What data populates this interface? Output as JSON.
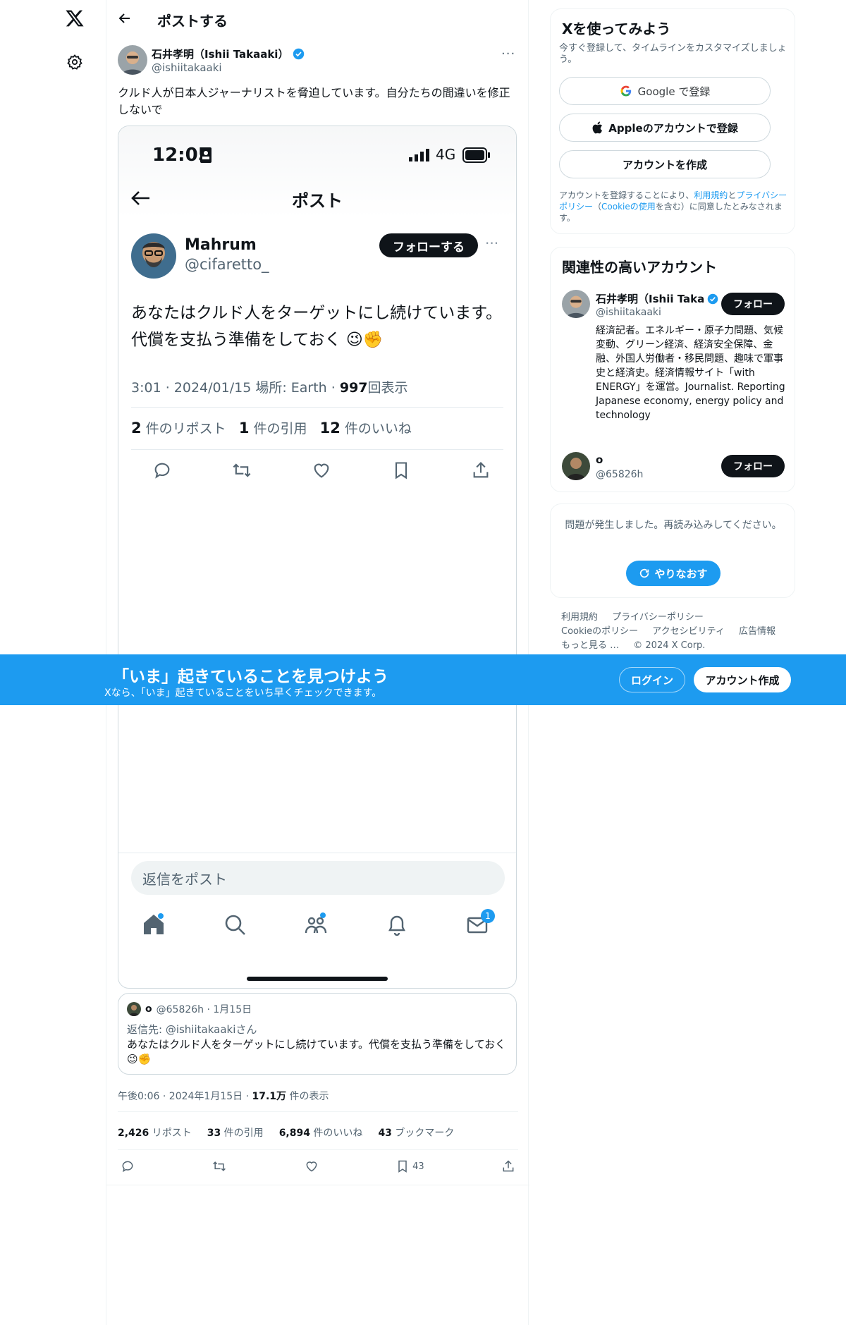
{
  "nav": {
    "logo": "x-logo-icon",
    "settings": "gear-icon"
  },
  "header": {
    "title": "ポストする"
  },
  "post": {
    "author_name": "石井孝明（Ishii Takaaki）",
    "author_handle": "@ishiitakaaki",
    "more": "···",
    "text": "クルド人が日本人ジャーナリストを脅迫しています。自分たちの間違いを修正しないで",
    "meta_time": "午後0:06 · 2024年1月15日 · ",
    "meta_views_num": "17.1万",
    "meta_views_label": " 件の表示",
    "stats": [
      {
        "num": "2,426",
        "label": " リポスト"
      },
      {
        "num": "33",
        "label": " 件の引用"
      },
      {
        "num": "6,894",
        "label": " 件のいいね"
      },
      {
        "num": "43",
        "label": " ブックマーク"
      }
    ],
    "bookmark_count": "43"
  },
  "embed": {
    "time": "12:05",
    "network": "4G",
    "title": "ポスト",
    "name": "Mahrum",
    "handle": "@cifaretto_",
    "follow": "フォローする",
    "text": "あなたはクルド人をターゲットにし続けています。代償を支払う準備をしておく 😉✊",
    "meta_time": "3:01 · 2024/01/15 場所: Earth · ",
    "meta_views": "997",
    "meta_views_label": "回表示",
    "reposts_num": "2",
    "reposts_label": "件のリポスト",
    "quotes_num": "1",
    "quotes_label": "件の引用",
    "likes_num": "12",
    "likes_label": "件のいいね",
    "reply_placeholder": "返信をポスト",
    "dm_badge": "1"
  },
  "quote": {
    "name": "o",
    "handle_date": "@65826h · 1月15日",
    "reply_to": "返信先: @ishiitakaakiさん",
    "text": "あなたはクルド人をターゲットにし続けています。代償を支払う準備をしておく 😉✊"
  },
  "signup_box": {
    "title": "Xを使ってみよう",
    "subtitle": "今すぐ登録して、タイムラインをカスタマイズしましょう。",
    "google": "Google で登録",
    "apple": "Appleのアカウントで登録",
    "create": "アカウントを作成",
    "terms_a": "アカウントを登録することにより、",
    "terms_link1": "利用規約",
    "terms_b": "と",
    "terms_link2": "プライバシーポリシー",
    "terms_c": "（",
    "terms_link3": "Cookieの使用",
    "terms_d": "を含む）に同意したとみなされます。"
  },
  "related": {
    "title": "関連性の高いアカウント",
    "accounts": [
      {
        "name": "石井孝明（Ishii Taka",
        "handle": "@ishiitakaaki",
        "follow": "フォロー",
        "bio": "経済記者。エネルギー・原子力問題、気候変動、グリーン経済、経済安全保障、金融、外国人労働者・移民問題、趣味で軍事史と経済史。経済情報サイト「with ENERGY」を運営。Journalist. Reporting Japanese economy, energy policy and technology"
      },
      {
        "name": "o",
        "handle": "@65826h",
        "follow": "フォロー"
      }
    ]
  },
  "error_box": {
    "message": "問題が発生しました。再読み込みしてください。",
    "retry": "やりなおす"
  },
  "footer": {
    "terms": "利用規約",
    "privacy": "プライバシーポリシー",
    "cookie": "Cookieのポリシー",
    "access": "アクセシビリティ",
    "ads": "広告情報",
    "more": "もっと見る …",
    "copyright": "© 2024 X Corp."
  },
  "banner": {
    "title": "「いま」起きていることを見つけよう",
    "subtitle": "Xなら、「いま」起きていることをいち早くチェックできます。",
    "login": "ログイン",
    "signup": "アカウント作成"
  },
  "colors": {
    "accent": "#1d9bf0",
    "text": "#0f1419",
    "muted": "#536471"
  }
}
